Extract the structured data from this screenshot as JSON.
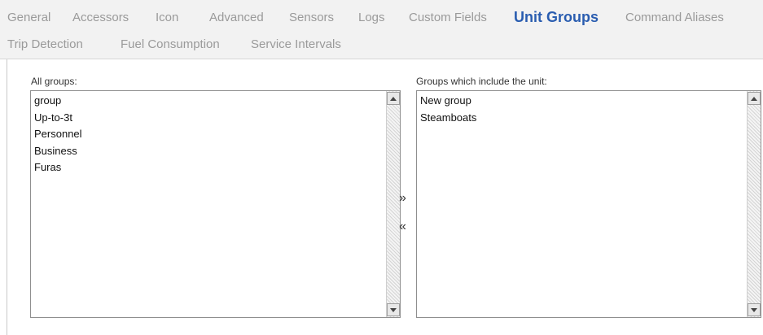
{
  "tabs": [
    {
      "label": "General",
      "active": false
    },
    {
      "label": "Accessors",
      "active": false
    },
    {
      "label": "Icon",
      "active": false
    },
    {
      "label": "Advanced",
      "active": false
    },
    {
      "label": "Sensors",
      "active": false
    },
    {
      "label": "Logs",
      "active": false
    },
    {
      "label": "Custom Fields",
      "active": false
    },
    {
      "label": "Unit Groups",
      "active": true
    },
    {
      "label": "Command Aliases",
      "active": false
    },
    {
      "label": "Trip Detection",
      "active": false
    },
    {
      "label": "Fuel Consumption",
      "active": false
    },
    {
      "label": "Service Intervals",
      "active": false
    }
  ],
  "all_groups": {
    "label": "All groups:",
    "items": [
      "group",
      "Up-to-3t",
      "Personnel",
      "Business",
      "Furas"
    ]
  },
  "unit_groups": {
    "label": "Groups which include the unit:",
    "items": [
      "New group",
      "Steamboats"
    ]
  },
  "move_buttons": {
    "add": "»",
    "remove": "«"
  }
}
